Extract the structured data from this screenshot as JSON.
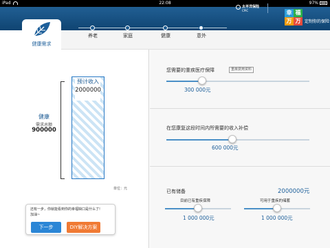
{
  "status": {
    "device": "iPad",
    "time": "22:08",
    "battery": "97%"
  },
  "brand": {
    "name": "太平洋保险",
    "sub": "CPIC",
    "slogan": "定制你的保险",
    "badges": [
      "幸",
      "福",
      "万",
      "万"
    ]
  },
  "tab": {
    "label": "健康需求"
  },
  "nav": {
    "steps": [
      "养老",
      "家庭",
      "健康",
      "意外"
    ]
  },
  "left": {
    "column_label": "预计收入",
    "column_value": "2000000",
    "need_label": "健康",
    "total_label": "需求总额",
    "total_value": "900000",
    "unit": "单位：元"
  },
  "prompt": {
    "question": "还有一步，你就能看到你的幸福缺口是什么了!",
    "sub": "加油~",
    "next_label": "下一步",
    "diy_label": "DIY解决方案"
  },
  "sections": {
    "medical": {
      "label": "您需要的重疾医疗保障",
      "link": "重疾费用资料",
      "value": "300 000元",
      "slider_fraction": 0.25
    },
    "income": {
      "label": "在您康复这段时间内所需要的收入补偿",
      "value": "600 000元",
      "slider_fraction": 0.46
    },
    "savings": {
      "label": "已有储备",
      "total": "2000000元",
      "left_label": "目前已有重疾保障",
      "left_value": "1 000 000元",
      "left_fraction": 0.5,
      "right_label": "可用于重疾的储蓄",
      "right_value": "1 000 000元",
      "right_fraction": 0.5
    }
  },
  "colors": {
    "primary": "#1d5f9a",
    "accent": "#f07a34",
    "button": "#2b86d6"
  }
}
